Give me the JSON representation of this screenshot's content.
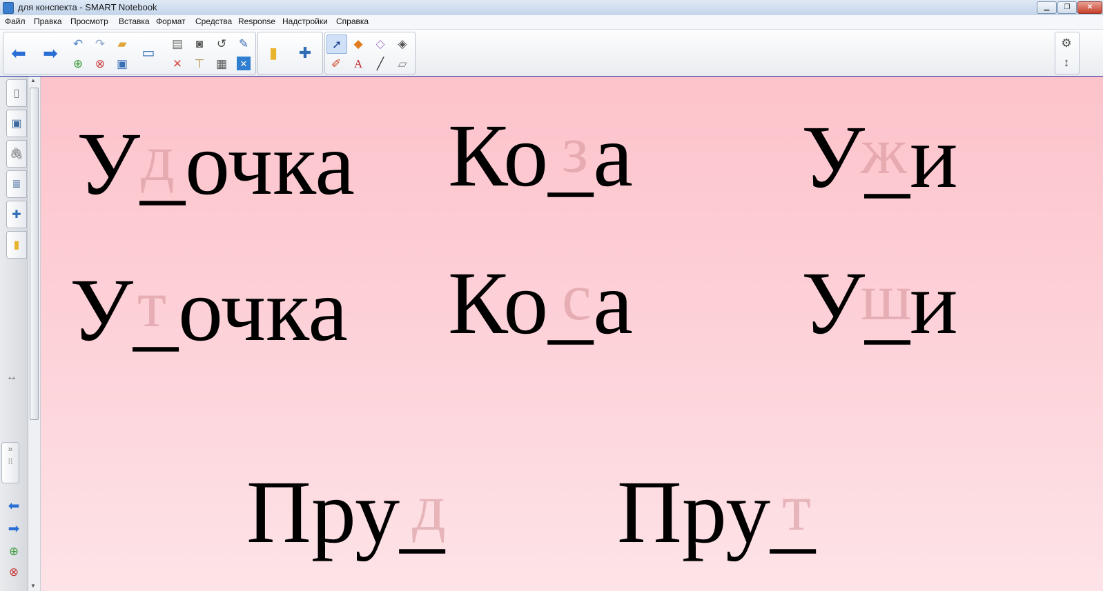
{
  "window": {
    "title": "для конспекта - SMART Notebook",
    "buttons": {
      "minimize": "▁",
      "maximize": "❐",
      "close": "✕"
    }
  },
  "menu": [
    "Файл",
    "Правка",
    "Просмотр",
    "Вставка",
    "Формат",
    "Средства",
    "Response",
    "Надстройки",
    "Справка"
  ],
  "toolbar": {
    "icons": [
      "back-arrow-icon",
      "forward-arrow-icon",
      "undo-icon",
      "redo-icon",
      "open-file-icon",
      "add-page-icon",
      "delete-page-icon",
      "save-icon",
      "screen-shade-icon",
      "paste-icon",
      "delete-icon",
      "screen-capture-icon",
      "display-icon",
      "table-icon",
      "rotate-icon",
      "close-x-icon",
      "lesson-activity-icon",
      "addon-icon",
      "select-pointer-icon",
      "pens-icon",
      "shapes-icon",
      "text-icon",
      "eraser-icon",
      "line-icon",
      "magic-pen-icon",
      "fill-icon",
      "settings-gear-icon",
      "move-toolbar-icon"
    ]
  },
  "sidebar": {
    "tabs": [
      "page-sorter-icon",
      "gallery-icon",
      "attachments-icon",
      "properties-icon",
      "addons-icon",
      "lesson-activity-icon"
    ],
    "resize_glyph": "↔",
    "bottom_icons": [
      "prev-page-icon",
      "next-page-icon",
      "add-page-icon",
      "delete-page-icon"
    ]
  },
  "canvas": {
    "background_colors": [
      "#fdc3cb",
      "#fde3e7"
    ],
    "words": [
      {
        "text": "У_очка",
        "hint": "д"
      },
      {
        "text": "Ко_а",
        "hint": "з"
      },
      {
        "text": "У_и",
        "hint": "ж"
      },
      {
        "text": "У_очка",
        "hint": "т"
      },
      {
        "text": "Ко_а",
        "hint": "с"
      },
      {
        "text": "У_и",
        "hint": "ш"
      },
      {
        "text": "Пру_",
        "hint": "д"
      },
      {
        "text": "Пру_",
        "hint": "т"
      }
    ]
  }
}
